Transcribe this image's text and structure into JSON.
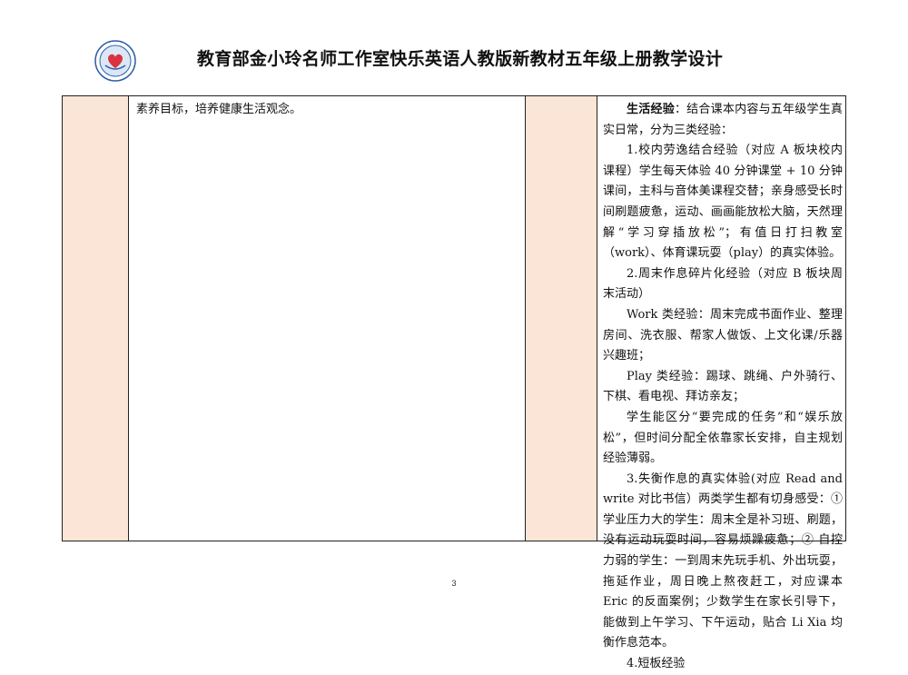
{
  "header": {
    "title": "教育部金小玲名师工作室快乐英语人教版新教材五年级上册教学设计",
    "logo_icon": "school-emblem-icon"
  },
  "table": {
    "col2_text": "素养目标，培养健康生活观念。",
    "col4": {
      "lead_bold": "生活经验",
      "lead_rest": "：结合课本内容与五年级学生真实日常，分为三类经验：",
      "paragraphs": [
        "1.校内劳逸结合经验（对应 A 板块校内课程）学生每天体验 40 分钟课堂 + 10 分钟课间，主科与音体美课程交替；亲身感受长时间刷题疲惫，运动、画画能放松大脑，天然理解“学习穿插放松”；有值日打扫教室（work）、体育课玩耍（play）的真实体验。",
        "2.周末作息碎片化经验（对应 B 板块周末活动）",
        "Work 类经验：周末完成书面作业、整理房间、洗衣服、帮家人做饭、上文化课/乐器兴趣班；",
        "Play 类经验：踢球、跳绳、户外骑行、下棋、看电视、拜访亲友；",
        "学生能区分“要完成的任务”和“娱乐放松”，但时间分配全依靠家长安排，自主规划经验薄弱。",
        "3.失衡作息的真实体验(对应 Read and write 对比书信）两类学生都有切身感受：① 学业压力大的学生：周末全是补习班、刷题，没有运动玩耍时间，容易烦躁疲惫；② 自控力弱的学生：一到周末先玩手机、外出玩耍，拖延作业，周日晚上熬夜赶工，对应课本 Eric 的反面案例；少数学生在家长引导下，能做到上午学习、下午运动，贴合 Li Xia 均衡作息范本。",
        "4.短板经验"
      ]
    }
  },
  "page_number": "3",
  "colors": {
    "shade": "#fbe5d6",
    "border": "#222222"
  }
}
